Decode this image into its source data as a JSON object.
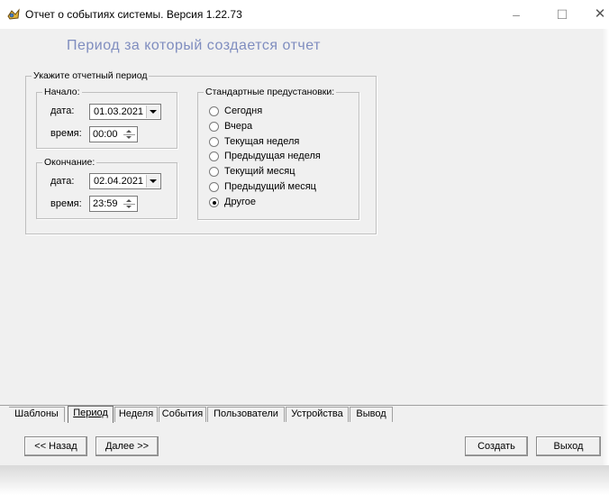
{
  "window": {
    "title": "Отчет о событиях системы.  Версия 1.22.73",
    "minimize_glyph": "–",
    "maximize_glyph": "☐",
    "close_glyph": "✕",
    "icon": "app-icon"
  },
  "heading": "Период за который создается отчет",
  "period": {
    "legend": "Укажите отчетный период",
    "start": {
      "legend": "Начало:",
      "date_label": "дата:",
      "date_value": "01.03.2021",
      "time_label": "время:",
      "time_value": "00:00"
    },
    "end": {
      "legend": "Окончание:",
      "date_label": "дата:",
      "date_value": "02.04.2021",
      "time_label": "время:",
      "time_value": "23:59"
    }
  },
  "presets": {
    "legend": "Стандартные предустановки:",
    "options": [
      {
        "label": "Сегодня",
        "checked": false
      },
      {
        "label": "Вчера",
        "checked": false
      },
      {
        "label": "Текущая неделя",
        "checked": false
      },
      {
        "label": "Предыдущая неделя",
        "checked": false
      },
      {
        "label": "Текущий месяц",
        "checked": false
      },
      {
        "label": "Предыдущий месяц",
        "checked": false
      },
      {
        "label": "Другое",
        "checked": true
      }
    ]
  },
  "tabs": [
    {
      "label": "Шаблоны",
      "active": false
    },
    {
      "label": "Период",
      "active": true
    },
    {
      "label": "Неделя",
      "active": false
    },
    {
      "label": "События",
      "active": false
    },
    {
      "label": "Пользователи",
      "active": false
    },
    {
      "label": "Устройства",
      "active": false
    },
    {
      "label": "Вывод",
      "active": false
    }
  ],
  "buttons": {
    "back": "<< Назад",
    "next": "Далее >>",
    "create": "Создать",
    "exit": "Выход"
  },
  "colors": {
    "heading": "#7f8dbf",
    "window_bg": "#f0f0f0"
  }
}
